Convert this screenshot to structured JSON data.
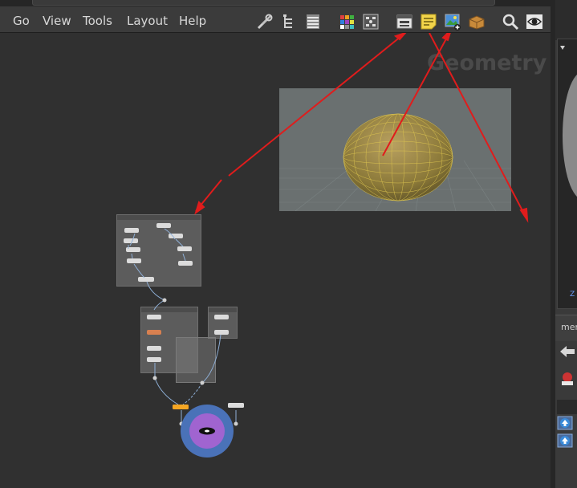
{
  "menu": {
    "items": [
      "Go",
      "View",
      "Tools",
      "Layout",
      "Help"
    ]
  },
  "toolbar": {
    "icons": [
      "tools-icon",
      "tree-icon",
      "list-icon",
      "color-palette-icon",
      "shape-palette-icon",
      "network-box-icon",
      "sticky-note-icon",
      "background-image-icon",
      "package-icon",
      "search-icon",
      "eye-icon"
    ]
  },
  "network": {
    "context_label": "Geometry",
    "colors": {
      "background": "#303030",
      "box": "#5c5c5c",
      "arrow": "#e01c1c",
      "wire": "#8fb0d8",
      "selected_node": "#f5a623"
    }
  },
  "right_panel": {
    "label": "mer"
  }
}
